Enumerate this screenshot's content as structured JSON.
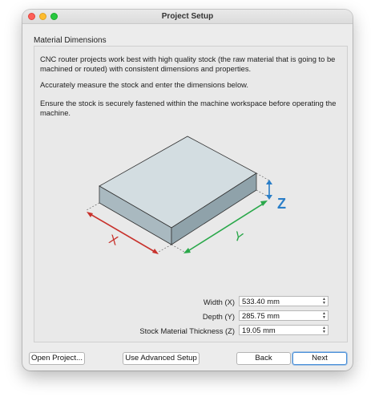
{
  "window": {
    "title": "Project Setup"
  },
  "section": {
    "title": "Material Dimensions",
    "paragraphs": [
      "CNC router projects work best with high quality stock (the raw material that is going to be machined or routed) with consistent dimensions and properties.",
      "Accurately measure the stock and enter the dimensions below.",
      "Ensure the stock is securely fastened within the machine workspace before operating the machine."
    ]
  },
  "diagram": {
    "x_label": "X",
    "y_label": "Y",
    "z_label": "Z",
    "colors": {
      "x": "#c8322c",
      "y": "#2aa84a",
      "z": "#2a7ec8",
      "stock": "#c9d5da"
    }
  },
  "fields": [
    {
      "label": "Width (X)",
      "value": "533.40 mm"
    },
    {
      "label": "Depth (Y)",
      "value": "285.75 mm"
    },
    {
      "label": "Stock Material Thickness (Z)",
      "value": "19.05 mm"
    }
  ],
  "buttons": {
    "open_project": "Open Project...",
    "advanced_setup": "Use Advanced Setup",
    "back": "Back",
    "next": "Next"
  }
}
